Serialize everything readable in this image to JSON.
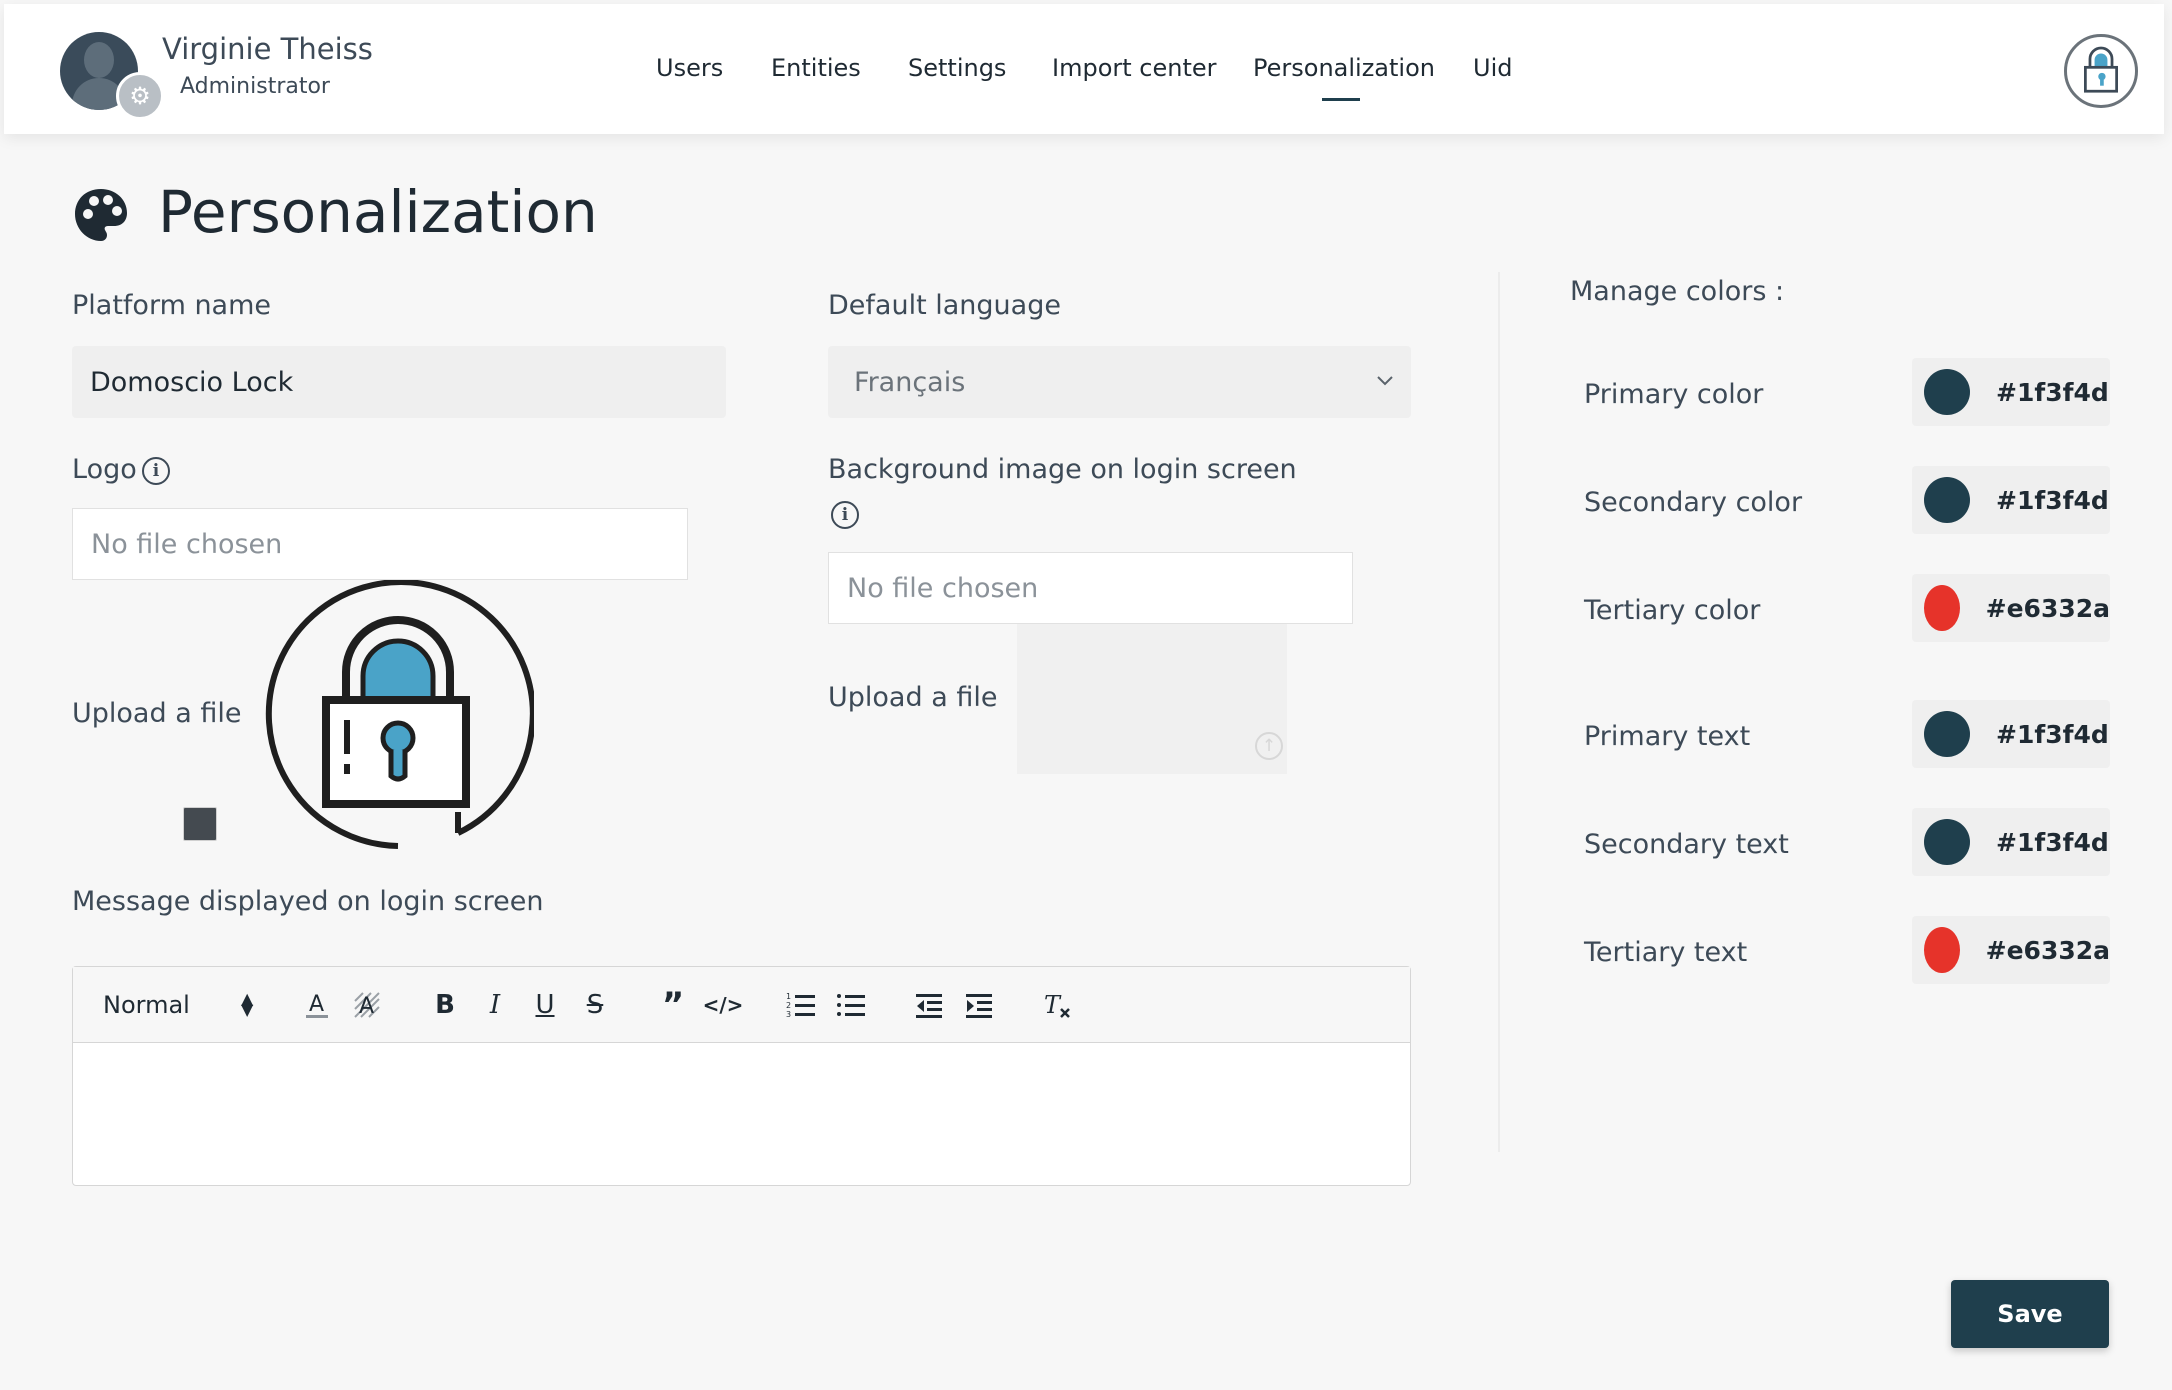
{
  "header": {
    "user_name": "Virginie Theiss",
    "user_role": "Administrator",
    "nav": [
      {
        "label": "Users"
      },
      {
        "label": "Entities"
      },
      {
        "label": "Settings"
      },
      {
        "label": "Import center"
      },
      {
        "label": "Personalization",
        "active": true
      },
      {
        "label": "Uid"
      }
    ]
  },
  "page": {
    "title": "Personalization",
    "icon": "palette-icon"
  },
  "form": {
    "platform_name_label": "Platform name",
    "platform_name_value": "Domoscio Lock",
    "default_language_label": "Default language",
    "default_language_value": "Français",
    "logo_label": "Logo",
    "logo_file_status": "No file chosen",
    "logo_upload_label": "Upload a file",
    "background_label": "Background image on login screen",
    "background_file_status": "No file chosen",
    "background_upload_label": "Upload a file",
    "message_label": "Message displayed on login screen"
  },
  "editor": {
    "format_value": "Normal",
    "tools": [
      "text-color",
      "background-color",
      "bold",
      "italic",
      "underline",
      "strike",
      "blockquote",
      "code-block",
      "ordered-list",
      "bullet-list",
      "outdent",
      "indent",
      "clean-formatting"
    ]
  },
  "colors": {
    "title": "Manage colors :",
    "items": [
      {
        "label": "Primary color",
        "hex": "#1f3f4d"
      },
      {
        "label": "Secondary color",
        "hex": "#1f3f4d"
      },
      {
        "label": "Tertiary color",
        "hex": "#e6332a"
      },
      {
        "label": "Primary text",
        "hex": "#1f3f4d"
      },
      {
        "label": "Secondary text",
        "hex": "#1f3f4d"
      },
      {
        "label": "Tertiary text",
        "hex": "#e6332a"
      }
    ],
    "display_hex": [
      "#1f3f4d",
      "#1f3f4d",
      "#e6332a",
      "#1f3f4d",
      "#1f3f4d",
      "#e6332a"
    ]
  },
  "actions": {
    "save_label": "Save"
  }
}
